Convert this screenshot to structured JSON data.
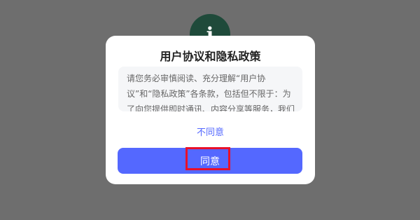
{
  "logo": {
    "glyph": "i",
    "color": "#1f4a3a"
  },
  "dialog": {
    "title": "用户协议和隐私政策",
    "content": "请您务必审慎阅读、充分理解“用户协议”和“隐私政策”各条款，包括但不限于：为了向您提供即时通讯、内容分享等服务，我们需要收集您的设备信息、操作日志等个人信息。",
    "disagree_label": "不同意",
    "agree_label": "同意"
  },
  "colors": {
    "overlay": "#6e6e6e",
    "accent": "#5468ff",
    "highlight": "#e8102a"
  }
}
